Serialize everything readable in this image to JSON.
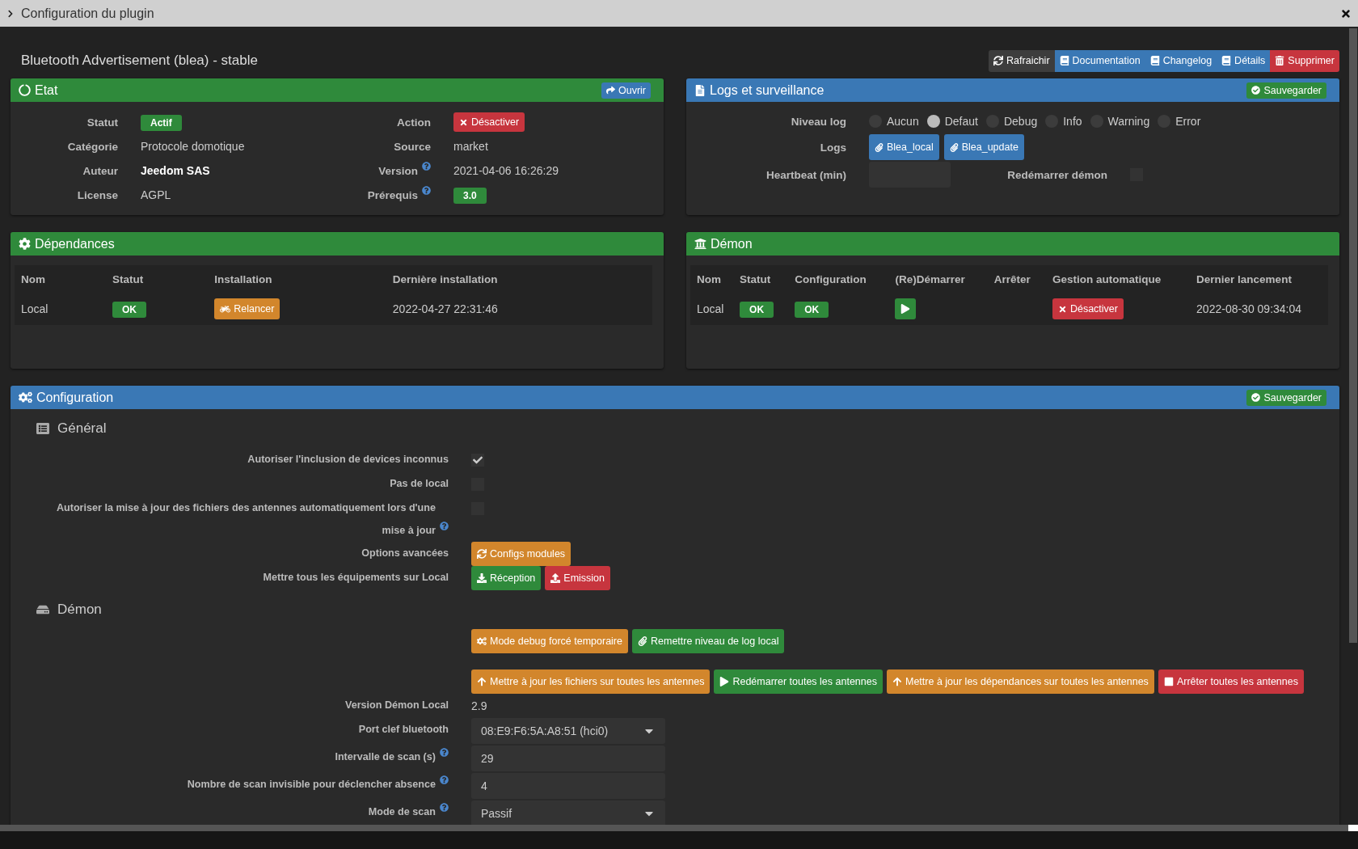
{
  "window": {
    "title": "Configuration du plugin"
  },
  "plugin_title": "Bluetooth Advertisement (blea) - stable",
  "toolbar": [
    {
      "label": "Rafraichir",
      "kind": "default"
    },
    {
      "label": "Documentation",
      "kind": "primary"
    },
    {
      "label": "Changelog",
      "kind": "primary"
    },
    {
      "label": "Détails",
      "kind": "primary"
    },
    {
      "label": "Supprimer",
      "kind": "danger"
    }
  ],
  "etat": {
    "title": "Etat",
    "kind": "success",
    "action": {
      "label": "Ouvrir",
      "kind": "primary"
    },
    "fields": [
      {
        "label": "Statut",
        "kind": "badge",
        "value": "Actif"
      },
      {
        "label": "Action",
        "kind": "danger_button",
        "value": "Désactiver"
      },
      {
        "label": "Catégorie",
        "kind": "text",
        "value": "Protocole domotique"
      },
      {
        "label": "Source",
        "kind": "text",
        "value": "market"
      },
      {
        "label": "Auteur",
        "kind": "strong",
        "value": "Jeedom SAS"
      },
      {
        "label": "Version",
        "help": true,
        "kind": "text",
        "value": "2021-04-06 16:26:29"
      },
      {
        "label": "License",
        "kind": "text",
        "value": "AGPL"
      },
      {
        "label": "Prérequis",
        "help": true,
        "kind": "badge",
        "value": "3.0"
      }
    ]
  },
  "logs": {
    "title": "Logs et surveillance",
    "kind": "primary",
    "save": {
      "label": "Sauvegarder",
      "kind": "success"
    },
    "level": {
      "label": "Niveau log",
      "options": [
        {
          "label": "Aucun",
          "selected": false
        },
        {
          "label": "Defaut",
          "selected": true
        },
        {
          "label": "Debug",
          "selected": false
        },
        {
          "label": "Info",
          "selected": false
        },
        {
          "label": "Warning",
          "selected": false
        },
        {
          "label": "Error",
          "selected": false
        }
      ]
    },
    "files": {
      "label": "Logs",
      "buttons": [
        {
          "label": "Blea_local",
          "kind": "primary"
        },
        {
          "label": "Blea_update",
          "kind": "primary"
        }
      ]
    },
    "heartbeat": {
      "label": "Heartbeat (min)"
    },
    "restart": {
      "label": "Redémarrer démon",
      "checked": false
    }
  },
  "dependances": {
    "title": "Dépendances",
    "kind": "success",
    "columns": [
      "Nom",
      "Statut",
      "Installation",
      "Dernière installation"
    ],
    "rows": [
      {
        "cells": [
          {
            "kind": "text",
            "value": "Local"
          },
          {
            "kind": "badge",
            "value": "OK"
          },
          {
            "kind": "warning_button",
            "value": "Relancer"
          },
          {
            "kind": "text",
            "value": "2022-04-27 22:31:46"
          }
        ]
      }
    ]
  },
  "demon": {
    "title": "Démon",
    "kind": "success",
    "columns": [
      "Nom",
      "Statut",
      "Configuration",
      "(Re)Démarrer",
      "Arrêter",
      "Gestion automatique",
      "Dernier lancement"
    ],
    "rows": [
      {
        "cells": [
          {
            "kind": "text",
            "value": "Local"
          },
          {
            "kind": "badge",
            "value": "OK"
          },
          {
            "kind": "badge",
            "value": "OK"
          },
          {
            "kind": "play_button"
          },
          {
            "kind": "blank"
          },
          {
            "kind": "danger_button",
            "value": "Désactiver"
          },
          {
            "kind": "text",
            "value": "2022-08-30 09:34:04"
          }
        ]
      }
    ]
  },
  "configuration": {
    "title": "Configuration",
    "kind": "primary",
    "save": {
      "label": "Sauvegarder",
      "kind": "success"
    },
    "sections": [
      {
        "title": "Général",
        "rows": [
          {
            "label": "Autoriser l'inclusion de devices inconnus",
            "kind": "checkbox",
            "checked": true
          },
          {
            "label": "Pas de local",
            "kind": "checkbox",
            "checked": false
          },
          {
            "label": "Autoriser la mise à jour des fichiers des antennes automatiquement lors d'une mise à jour",
            "help": true,
            "kind": "checkbox",
            "checked": false
          },
          {
            "label": "Options avancées",
            "kind": "buttons",
            "buttons": [
              {
                "label": "Configs modules",
                "kind": "warning"
              }
            ]
          },
          {
            "label": "Mettre tous les équipements sur Local",
            "kind": "buttons",
            "buttons": [
              {
                "label": "Réception",
                "kind": "success"
              },
              {
                "label": "Emission",
                "kind": "danger"
              }
            ]
          }
        ]
      },
      {
        "title": "Démon",
        "rows": [
          {
            "kind": "buttons",
            "buttons": [
              {
                "label": "Mode debug forcé temporaire",
                "kind": "warning"
              },
              {
                "label": "Remettre niveau de log local",
                "kind": "success"
              }
            ]
          },
          {
            "kind": "buttons",
            "buttons": [
              {
                "label": "Mettre à jour les fichiers sur toutes les antennes",
                "kind": "warning"
              },
              {
                "label": "Redémarrer toutes les antennes",
                "kind": "success"
              },
              {
                "label": "Mettre à jour les dépendances sur toutes les antennes",
                "kind": "warning"
              },
              {
                "label": "Arrêter toutes les antennes",
                "kind": "danger"
              }
            ]
          },
          {
            "label": "Version Démon Local",
            "kind": "text",
            "value": "2.9"
          },
          {
            "label": "Port clef bluetooth",
            "kind": "select",
            "value": "08:E9:F6:5A:A8:51 (hci0)"
          },
          {
            "label": "Intervalle de scan (s)",
            "help": true,
            "kind": "input",
            "value": "29"
          },
          {
            "label": "Nombre de scan invisible pour déclencher absence",
            "help": true,
            "kind": "input",
            "value": "4"
          },
          {
            "label": "Mode de scan",
            "help": true,
            "kind": "select",
            "value": "Passif"
          }
        ]
      }
    ]
  }
}
